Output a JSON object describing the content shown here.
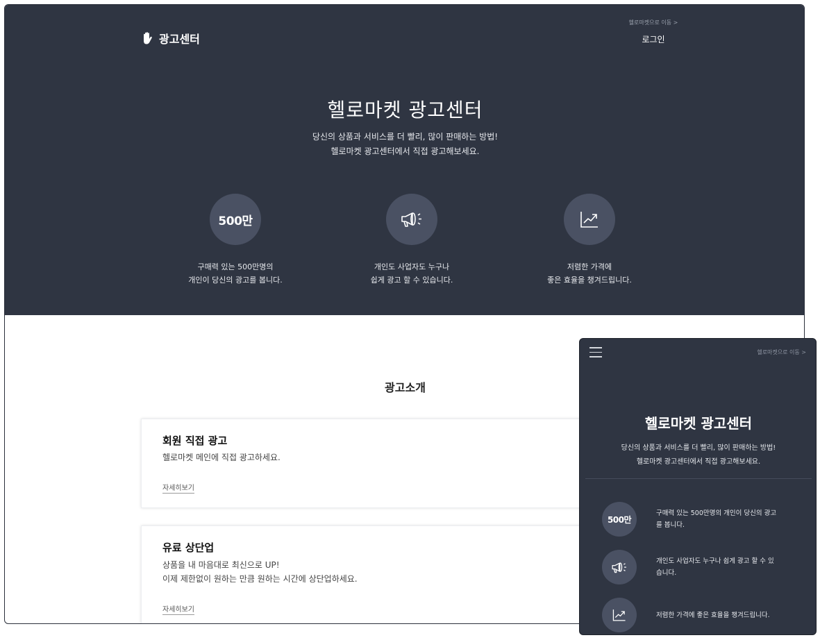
{
  "header": {
    "logo_text": "광고센터",
    "hello_link": "헬로마켓으로 이동 >",
    "login": "로그인"
  },
  "hero": {
    "title": "헬로마켓 광고센터",
    "subtitle_line1": "당신의 상품과 서비스를 더 빨리, 많이 판매하는 방법!",
    "subtitle_line2": "헬로마켓 광고센터에서 직접 광고해보세요."
  },
  "features": [
    {
      "icon": "number-badge",
      "value": "500만",
      "desc_line1": "구매력 있는 500만명의",
      "desc_line2": "개인이 당신의 광고를 봅니다."
    },
    {
      "icon": "megaphone-icon",
      "desc_line1": "개인도 사업자도 누구나",
      "desc_line2": "쉽게 광고 할 수 있습니다."
    },
    {
      "icon": "trend-chart-icon",
      "desc_line1": "저렴한 가격에",
      "desc_line2": "좋은 효율을 챙겨드립니다."
    }
  ],
  "intro": {
    "title": "광고소개",
    "cards": [
      {
        "title": "회원 직접 광고",
        "text_line1": "헬로마켓 메인에 직접 광고하세요.",
        "text_line2": "",
        "more": "자세히보기"
      },
      {
        "title": "유료 상단업",
        "text_line1": "상품을 내 마음대로 최신으로 UP!",
        "text_line2": "이제 제한없이 원하는 만큼 원하는 시간에 상단업하세요.",
        "more": "자세히보기"
      }
    ]
  },
  "mobile": {
    "hello_link": "헬로마켓으로 이동 >",
    "title": "헬로마켓 광고센터",
    "subtitle_line1": "당신의 상품과 서비스를 더 빨리, 많이 판매하는 방법!",
    "subtitle_line2": "헬로마켓 광고센터에서 직접 광고해보세요.",
    "features": [
      {
        "value": "500만",
        "desc_line1": "구매력 있는 500만명의 개인이 당신의 광고",
        "desc_line2": "를 봅니다."
      },
      {
        "desc_line1": "개인도 사업자도 누구나 쉽게 광고 할 수 있",
        "desc_line2": "습니다."
      },
      {
        "desc_line1": "저렴한 가격에 좋은 효율을 챙겨드립니다.",
        "desc_line2": ""
      }
    ]
  },
  "colors": {
    "hero_bg": "#2f3542",
    "circle_bg": "#4a5163",
    "text_light": "#e6e8ec"
  }
}
